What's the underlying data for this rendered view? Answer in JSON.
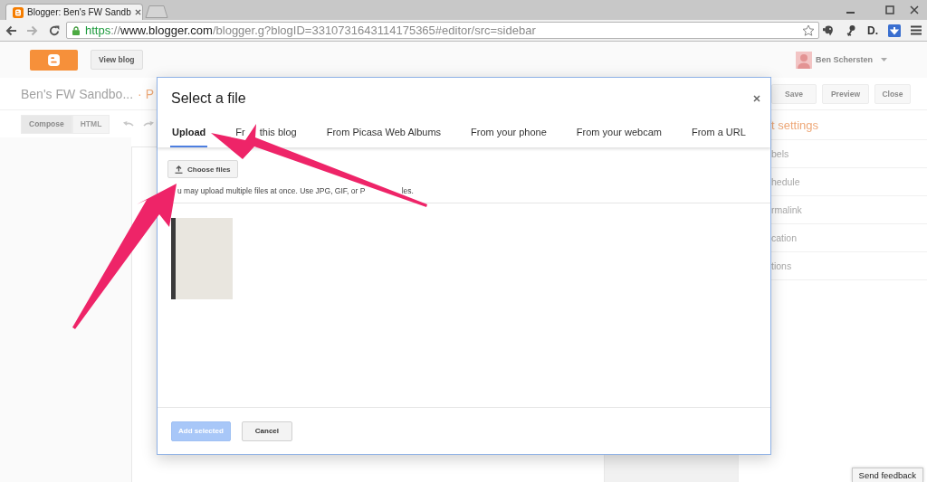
{
  "browser": {
    "tabs": [
      {
        "title": "Blogger: Ben's FW Sandb",
        "selected": true
      }
    ],
    "url_parts": [
      {
        "kind": "scheme",
        "text": "https"
      },
      {
        "kind": "plain",
        "text": "://"
      },
      {
        "kind": "host",
        "text": "www.blogger.com"
      },
      {
        "kind": "plain",
        "text": "/blogger.g?blogID=3310731643114175365#editor/src=sidebar"
      }
    ],
    "extensions": [
      {
        "kind": "elephant"
      },
      {
        "kind": "pin"
      },
      {
        "kind": "text",
        "label": "D."
      },
      {
        "kind": "download"
      }
    ]
  },
  "header": {
    "view_blog": "View blog",
    "user": "Ben Schersten"
  },
  "post_bar": {
    "blog_title": "Ben's FW Sandbo...",
    "post_title": "· P",
    "buttons": [
      "Save",
      "Preview",
      "Close"
    ]
  },
  "editor_toolbar": {
    "modes": [
      {
        "label": "Compose",
        "selected": true
      },
      {
        "label": "HTML",
        "selected": false
      }
    ]
  },
  "sidebar": {
    "title": "t settings",
    "items": [
      "bels",
      "hedule",
      "rmalink",
      "cation",
      "tions"
    ]
  },
  "dialog": {
    "title": "Select a file",
    "tabs": [
      {
        "label": "Upload",
        "selected": true
      },
      {
        "label_parts": [
          "Fr",
          "this blog"
        ],
        "selected": false
      },
      {
        "label": "From Picasa Web Albums",
        "selected": false
      },
      {
        "label": "From your phone",
        "selected": false
      },
      {
        "label": "From your webcam",
        "selected": false
      },
      {
        "label": "From a URL",
        "selected": false
      }
    ],
    "choose_button": "Choose files",
    "hint_parts": [
      "u may upload multiple files at once. Use JPG, GIF, or P",
      "les."
    ],
    "files": [
      {
        "kind": "photo"
      }
    ],
    "buttons": [
      {
        "label": "Add selected",
        "kind": "primary",
        "disabled": true
      },
      {
        "label": "Cancel",
        "kind": "default",
        "disabled": false
      }
    ]
  },
  "feedback_button": "Send feedback"
}
